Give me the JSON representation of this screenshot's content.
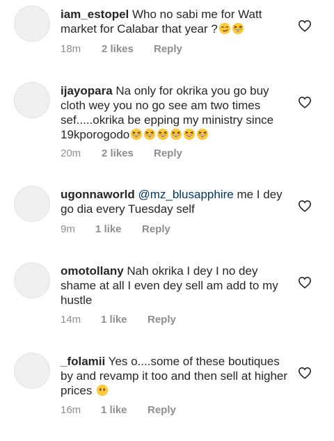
{
  "comments": [
    {
      "username": "iam_estopel",
      "mention": "",
      "text": "Who no sabi me for Watt market for Calabar that year ?",
      "emojis": [
        "smirk-face-emoji",
        "grinning-squint-face-emoji"
      ],
      "time": "18m",
      "likes": "2 likes",
      "reply": "Reply"
    },
    {
      "username": "ijayopara",
      "mention": "",
      "text": "Na only for okrika you go buy cloth wey you no go see am two times sef.....okrika be epping my ministry since 19kporogodo",
      "emojis": [
        "grinning-squint-face-emoji",
        "grinning-squint-face-emoji",
        "grinning-squint-face-emoji",
        "grinning-squint-face-emoji",
        "grinning-squint-face-emoji",
        "grinning-squint-face-emoji"
      ],
      "time": "20m",
      "likes": "2 likes",
      "reply": "Reply"
    },
    {
      "username": "ugonnaworld",
      "mention": "@mz_blusapphire",
      "text": "me I dey go dia every Tuesday self",
      "emojis": [],
      "time": "9m",
      "likes": "1 like",
      "reply": "Reply"
    },
    {
      "username": "omotollany",
      "mention": "",
      "text": "Nah okrika I dey I no dey shame at all I even dey sell am add to my hustle",
      "emojis": [],
      "time": "14m",
      "likes": "1 like",
      "reply": "Reply"
    },
    {
      "username": "_folamii",
      "mention": "",
      "text": "Yes o....some of these boutiques by and revamp it too and then sell at higher prices",
      "emojis": [
        "face-without-mouth-emoji"
      ],
      "time": "16m",
      "likes": "1 like",
      "reply": "Reply"
    }
  ],
  "icons": {
    "heart": "heart-outline-icon"
  },
  "colors": {
    "text": "#262626",
    "meta": "#8e8e8e",
    "mention": "#003569",
    "emoji_yellow": "#FFC83D"
  }
}
